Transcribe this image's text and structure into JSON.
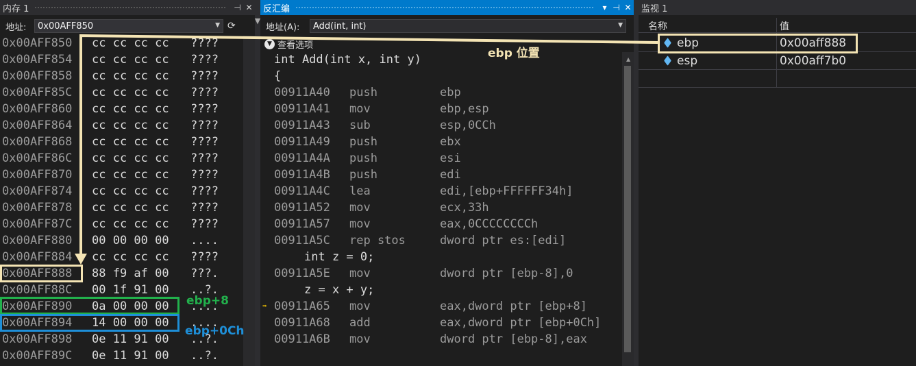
{
  "memory": {
    "title": "内存 1",
    "address_label": "地址:",
    "address_value": "0x00AFF850",
    "refresh_glyph": "⟳",
    "rows": [
      {
        "addr": "0x00AFF850",
        "bytes": "cc cc cc cc",
        "chars": "????"
      },
      {
        "addr": "0x00AFF854",
        "bytes": "cc cc cc cc",
        "chars": "????"
      },
      {
        "addr": "0x00AFF858",
        "bytes": "cc cc cc cc",
        "chars": "????"
      },
      {
        "addr": "0x00AFF85C",
        "bytes": "cc cc cc cc",
        "chars": "????"
      },
      {
        "addr": "0x00AFF860",
        "bytes": "cc cc cc cc",
        "chars": "????"
      },
      {
        "addr": "0x00AFF864",
        "bytes": "cc cc cc cc",
        "chars": "????"
      },
      {
        "addr": "0x00AFF868",
        "bytes": "cc cc cc cc",
        "chars": "????"
      },
      {
        "addr": "0x00AFF86C",
        "bytes": "cc cc cc cc",
        "chars": "????"
      },
      {
        "addr": "0x00AFF870",
        "bytes": "cc cc cc cc",
        "chars": "????"
      },
      {
        "addr": "0x00AFF874",
        "bytes": "cc cc cc cc",
        "chars": "????"
      },
      {
        "addr": "0x00AFF878",
        "bytes": "cc cc cc cc",
        "chars": "????"
      },
      {
        "addr": "0x00AFF87C",
        "bytes": "cc cc cc cc",
        "chars": "????"
      },
      {
        "addr": "0x00AFF880",
        "bytes": "00 00 00 00",
        "chars": "...."
      },
      {
        "addr": "0x00AFF884",
        "bytes": "cc cc cc cc",
        "chars": "????"
      },
      {
        "addr": "0x00AFF888",
        "bytes": "88 f9 af 00",
        "chars": "???."
      },
      {
        "addr": "0x00AFF88C",
        "bytes": "00 1f 91 00",
        "chars": "..?."
      },
      {
        "addr": "0x00AFF890",
        "bytes": "0a 00 00 00",
        "chars": "...."
      },
      {
        "addr": "0x00AFF894",
        "bytes": "14 00 00 00",
        "chars": "...."
      },
      {
        "addr": "0x00AFF898",
        "bytes": "0e 11 91 00",
        "chars": "..?."
      },
      {
        "addr": "0x00AFF89C",
        "bytes": "0e 11 91 00",
        "chars": "..?."
      }
    ]
  },
  "disassembly": {
    "title": "反汇编",
    "address_label": "地址(A):",
    "address_value": "Add(int, int)",
    "view_options": "查看选项",
    "lines": [
      {
        "kind": "src",
        "indent": 0,
        "text": "int Add(int x, int y)"
      },
      {
        "kind": "src",
        "indent": 0,
        "text": "{"
      },
      {
        "kind": "asm",
        "addr": "00911A40",
        "mn": "push",
        "op": "ebp"
      },
      {
        "kind": "asm",
        "addr": "00911A41",
        "mn": "mov",
        "op": "ebp,esp"
      },
      {
        "kind": "asm",
        "addr": "00911A43",
        "mn": "sub",
        "op": "esp,0CCh"
      },
      {
        "kind": "asm",
        "addr": "00911A49",
        "mn": "push",
        "op": "ebx"
      },
      {
        "kind": "asm",
        "addr": "00911A4A",
        "mn": "push",
        "op": "esi"
      },
      {
        "kind": "asm",
        "addr": "00911A4B",
        "mn": "push",
        "op": "edi"
      },
      {
        "kind": "asm",
        "addr": "00911A4C",
        "mn": "lea",
        "op": "edi,[ebp+FFFFFF34h]"
      },
      {
        "kind": "asm",
        "addr": "00911A52",
        "mn": "mov",
        "op": "ecx,33h"
      },
      {
        "kind": "asm",
        "addr": "00911A57",
        "mn": "mov",
        "op": "eax,0CCCCCCCCh"
      },
      {
        "kind": "asm",
        "addr": "00911A5C",
        "mn": "rep stos",
        "op": "dword ptr es:[edi]"
      },
      {
        "kind": "src",
        "indent": 1,
        "text": "int z = 0;"
      },
      {
        "kind": "asm",
        "addr": "00911A5E",
        "mn": "mov",
        "op": "dword ptr [ebp-8],0"
      },
      {
        "kind": "src",
        "indent": 1,
        "text": "z = x + y;"
      },
      {
        "kind": "asm",
        "addr": "00911A65",
        "mn": "mov",
        "op": "eax,dword ptr [ebp+8]",
        "current": true
      },
      {
        "kind": "asm",
        "addr": "00911A68",
        "mn": "add",
        "op": "eax,dword ptr [ebp+0Ch]"
      },
      {
        "kind": "asm",
        "addr": "00911A6B",
        "mn": "mov",
        "op": "dword ptr [ebp-8],eax"
      }
    ]
  },
  "watch": {
    "title": "监视 1",
    "col_name": "名称",
    "col_value": "值",
    "rows": [
      {
        "name": "ebp",
        "value": "0x00aff888"
      },
      {
        "name": "esp",
        "value": "0x00aff7b0"
      }
    ]
  },
  "annotations": {
    "ebp_position": "ebp  位置",
    "ebp_plus_8": "ebp+8",
    "ebp_plus_0ch": "ebp+0Ch"
  },
  "colors": {
    "annotation_beige": "#f4e4b4",
    "annotation_green": "#22b14c",
    "annotation_blue": "#1e8fd8",
    "title_active": "#007acc"
  }
}
